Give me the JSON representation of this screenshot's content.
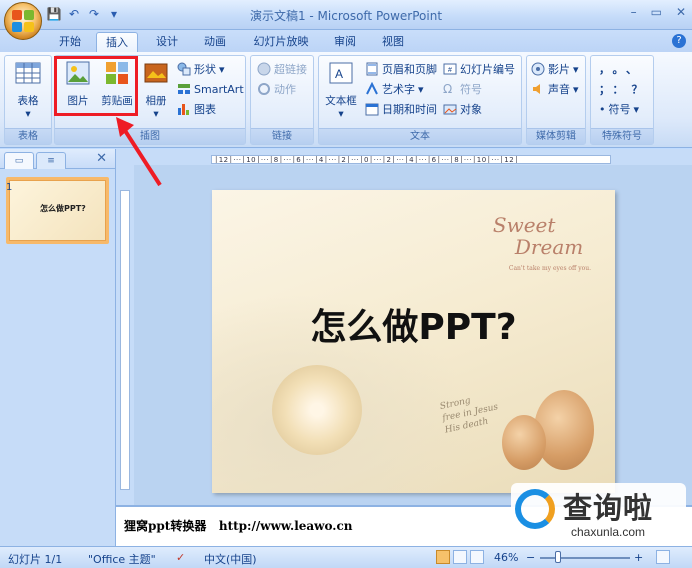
{
  "window": {
    "title": "演示文稿1 - Microsoft PowerPoint",
    "minimize": "–",
    "restore": "▭",
    "close": "✕"
  },
  "qat": {
    "save": "💾",
    "undo": "↶",
    "redo": "↷",
    "more": "▾"
  },
  "tabs": [
    {
      "label": "开始"
    },
    {
      "label": "插入",
      "active": true
    },
    {
      "label": "设计"
    },
    {
      "label": "动画"
    },
    {
      "label": "幻灯片放映"
    },
    {
      "label": "审阅"
    },
    {
      "label": "视图"
    }
  ],
  "help": "?",
  "ribbon": {
    "table_group": {
      "label": "表格",
      "table_btn": "表格"
    },
    "illus_group": {
      "label": "插图",
      "picture_btn": "图片",
      "clipart_btn": "剪贴画",
      "album_btn": "相册",
      "shapes_btn": "形状",
      "smartart_btn": "SmartArt",
      "chart_btn": "图表"
    },
    "links_group": {
      "label": "链接",
      "hyperlink_btn": "超链接",
      "action_btn": "动作"
    },
    "text_group": {
      "label": "文本",
      "textbox_btn": "文本框",
      "headerfooter_btn": "页眉和页脚",
      "wordart_btn": "艺术字",
      "datetime_btn": "日期和时间",
      "slidenum_btn": "幻灯片编号",
      "symbol_btn": "符号",
      "object_btn": "对象"
    },
    "media_group": {
      "label": "媒体剪辑",
      "movie_btn": "影片",
      "sound_btn": "声音"
    },
    "special_group": {
      "label": "特殊符号",
      "row1": "，。、",
      "row2": "；：？",
      "symbol_btn": "符号"
    }
  },
  "left_pane": {
    "tab1": "▭",
    "tab2": "≡",
    "close": "✕",
    "slide_number": "1",
    "thumb_title": "怎么做PPT?"
  },
  "ruler": {
    "h_text": "│12│···│10│···│8│···│6│···│4│···│2│···│0│···│2│···│4│···│6│···│8│···│10│···│12│"
  },
  "slide": {
    "title": "怎么做PPT?",
    "sweet": "Sweet",
    "dream": "Dream",
    "tagline": "Can't take my eyes off you.",
    "book_text": "Strong\nfree in Jesus\nHis death"
  },
  "notes": {
    "text": "狸窝ppt转换器   http://www.leawo.cn"
  },
  "watermark": {
    "text": "查询啦",
    "sub": "chaxunla.com"
  },
  "status": {
    "slide_info": "幻灯片 1/1",
    "theme": "\"Office 主题\"",
    "lang": "中文(中国)",
    "zoom": "46%",
    "minus": "−",
    "plus": "+"
  }
}
